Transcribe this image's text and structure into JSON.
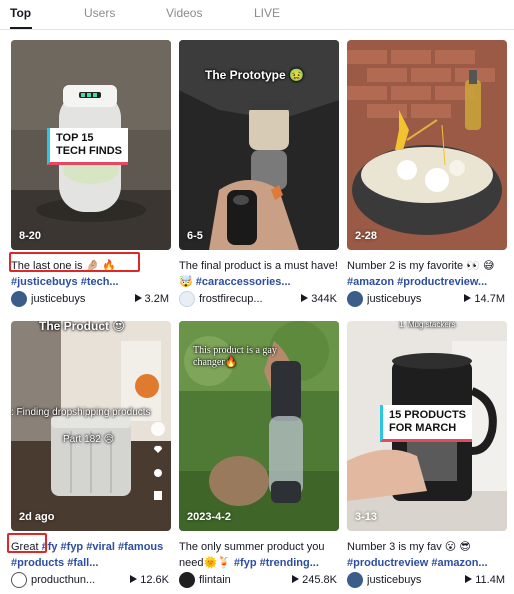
{
  "tabs": [
    {
      "label": "Top",
      "active": true
    },
    {
      "label": "Users"
    },
    {
      "label": "Videos"
    },
    {
      "label": "LIVE"
    }
  ],
  "videos": [
    {
      "date": "8-20",
      "overlay": "TOP 15\nTECH FINDS",
      "caption_text": "The last one is 🤌🏼 🔥",
      "caption_tags": "#justicebuys #tech...",
      "author": "justicebuys",
      "views": "3.2M",
      "highlighted": true
    },
    {
      "date": "6-5",
      "overlay": "The Prototype 🤢",
      "caption_text": "The final product is a must have! 🤯 ",
      "caption_tags": "#caraccessories...",
      "author": "frostfirecup...",
      "views": "344K"
    },
    {
      "date": "2-28",
      "caption_text": "Number 2 is my favorite 👀 😅 ",
      "caption_tags": "#amazon #productreview...",
      "author": "justicebuys",
      "views": "14.7M"
    },
    {
      "date": "2d ago",
      "overlay": "The Product 😍",
      "overlay2": ": Finding dropshipping products",
      "overlay3": "Part 182 😥",
      "caption_text": "Great ",
      "caption_tags": "#fy #fyp #viral #famous #products #fall...",
      "author": "producthun...",
      "views": "12.6K",
      "highlighted": true
    },
    {
      "date": "2023-4-2",
      "overlay": "This product is a gay\nchanger🔥",
      "caption_text": "The only summer product you need🌞🍹 ",
      "caption_tags": "#fyp #trending...",
      "author": "flintain",
      "views": "245.8K"
    },
    {
      "date": "3-13",
      "overlay": "15 PRODUCTS\nFOR MARCH",
      "overlay2": "1. Mug stackers",
      "caption_text": "Number 3 is my fav 😮 😎 ",
      "caption_tags": "#productreview #amazon...",
      "author": "justicebuys",
      "views": "11.4M"
    }
  ],
  "colors": {
    "accent_red": "#e02727",
    "hashtag_blue": "#2c4da1",
    "tab_inactive": "#8a8b91"
  },
  "icons": [
    "play-icon"
  ]
}
